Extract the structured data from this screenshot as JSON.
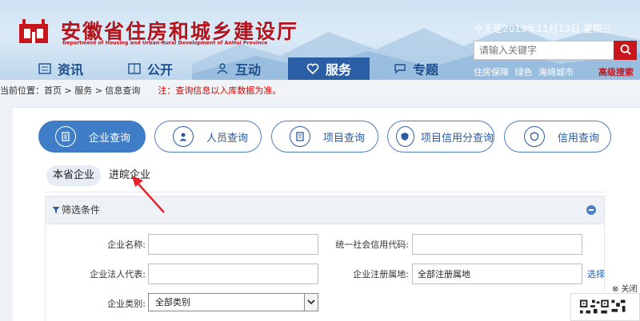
{
  "header": {
    "title": "安徽省住房和城乡建设厅",
    "subtitle": "Department of Housing and Urban-Rural Development of AnHui Province",
    "date_text": "今天是2019年11月13日  星期三",
    "search_placeholder": "请输入关键字",
    "hot_links": [
      "住房保障",
      "绿色",
      "海绵城市"
    ],
    "advanced_search": "高级搜索"
  },
  "nav": {
    "items": [
      {
        "label": "资讯",
        "icon": "list-icon"
      },
      {
        "label": "公开",
        "icon": "book-icon"
      },
      {
        "label": "互动",
        "icon": "people-icon"
      },
      {
        "label": "服务",
        "icon": "heart-icon",
        "active": true
      },
      {
        "label": "专题",
        "icon": "chat-icon"
      }
    ],
    "active_color": "#2a5ea5"
  },
  "breadcrumb": {
    "text": "当前位置：首页 > 服务 > 信息查询",
    "note": "注：查询信息以入库数据为准。"
  },
  "query_tabs": [
    {
      "label": "企业查询",
      "icon": "company-icon",
      "active": true
    },
    {
      "label": "人员查询",
      "icon": "person-icon"
    },
    {
      "label": "项目查询",
      "icon": "project-icon"
    },
    {
      "label": "项目信用分查询",
      "icon": "shield-icon"
    },
    {
      "label": "信用查询",
      "icon": "credit-icon"
    }
  ],
  "sub_tabs": [
    {
      "label": "本省企业",
      "active": true
    },
    {
      "label": "进皖企业"
    }
  ],
  "filter": {
    "title": "筛选条件",
    "fields": {
      "company_name_label": "企业名称:",
      "credit_code_label": "统一社会信用代码:",
      "legal_rep_label": "企业法人代表:",
      "reg_place_label": "企业注册属地:",
      "reg_place_value": "全部注册属地",
      "choose_label": "选择",
      "category_label": "企业类别:",
      "category_value": "全部类别"
    }
  },
  "close_label": "⊗ 关闭",
  "colors": {
    "brand_red": "#b3131b",
    "accent_blue": "#3f7dc7",
    "annotation_red": "#e8222a"
  }
}
